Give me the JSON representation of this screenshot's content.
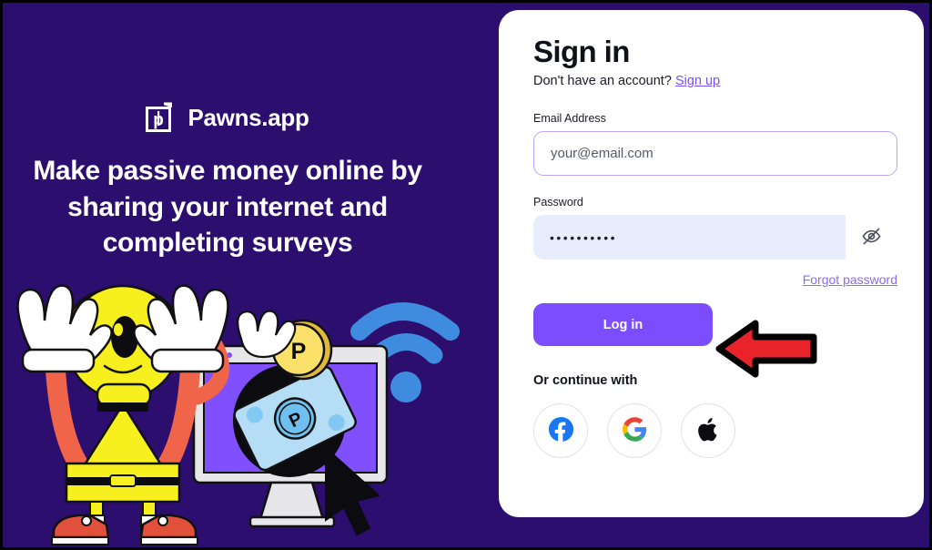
{
  "theme": {
    "bg_purple": "#2B0E6E",
    "accent_purple": "#7C4DFD",
    "link_purple": "#8B6BF0",
    "card_bg": "#FFFFFF",
    "password_field_bg": "#E8EDFB",
    "annotation_red": "#E8232A"
  },
  "left_panel": {
    "logo_icon": "pawns-logo-icon",
    "brand_name": "Pawns.app",
    "headline": "Make passive money online by sharing your internet and completing surveys",
    "illustration": {
      "character": "yellow-one-eyed-mascot",
      "monitor": "desktop-monitor-icon",
      "banknote": "banknote-icon",
      "coin": "p-coin-icon",
      "wifi": "wifi-signal-icon",
      "cursor": "cursor-arrow-icon"
    }
  },
  "card": {
    "title": "Sign in",
    "subtitle_text": "Don't have an account?",
    "signup_link": "Sign up",
    "email": {
      "label": "Email Address",
      "placeholder": "your@email.com",
      "value": ""
    },
    "password": {
      "label": "Password",
      "value": "••••••••••",
      "toggle_icon": "eye-off-icon"
    },
    "forgot_link": "Forgot password",
    "login_button": "Log in",
    "continue_label": "Or continue with",
    "social": [
      {
        "name": "facebook",
        "icon": "facebook-icon"
      },
      {
        "name": "google",
        "icon": "google-icon"
      },
      {
        "name": "apple",
        "icon": "apple-icon"
      }
    ]
  },
  "annotation": {
    "arrow_icon": "red-left-arrow-annotation",
    "points_at": "Log in"
  }
}
